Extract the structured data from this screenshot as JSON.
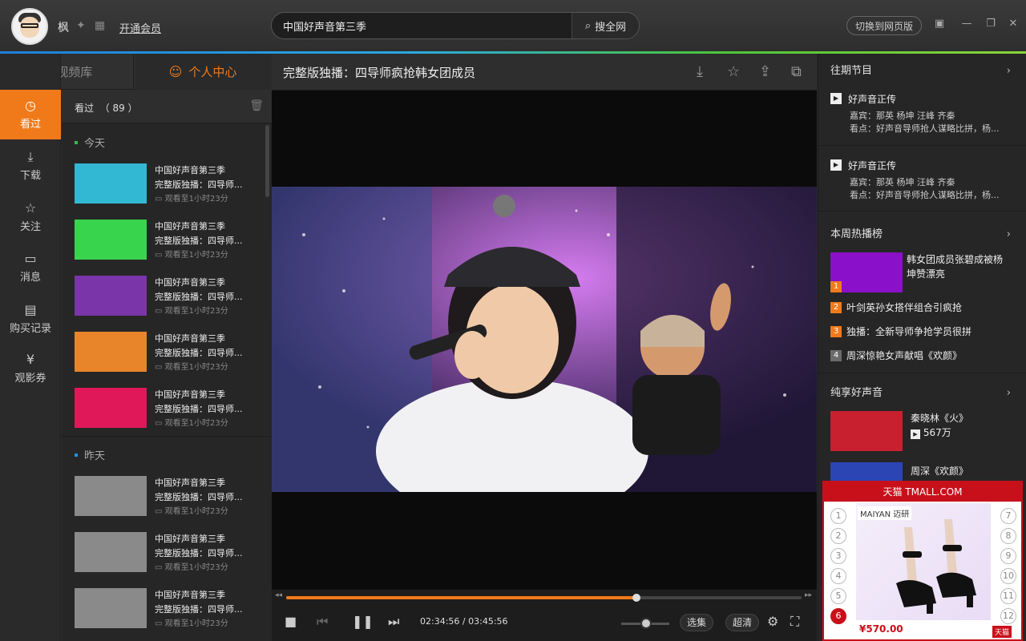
{
  "header": {
    "username": "枫",
    "vip_link": "开通会员",
    "search_value": "中国好声音第三季",
    "search_button": "搜全网",
    "switch_button": "切换到网页版"
  },
  "tabs": [
    {
      "label": "视频库"
    },
    {
      "label": "个人中心"
    }
  ],
  "leftnav": [
    {
      "label": "看过",
      "icon": "clock-icon",
      "active": true
    },
    {
      "label": "下载",
      "icon": "download-icon"
    },
    {
      "label": "关注",
      "icon": "star-icon"
    },
    {
      "label": "消息",
      "icon": "message-icon"
    },
    {
      "label": "购买记录",
      "icon": "receipt-icon"
    },
    {
      "label": "观影券",
      "icon": "ticket-icon"
    }
  ],
  "history": {
    "title": "看过",
    "count": "（ 89 ）",
    "today_label": "今天",
    "yesterday_label": "昨天",
    "today": [
      {
        "title": "中国好声音第三季",
        "subtitle": "完整版独播：四导师...",
        "progress": "观看至1小时23分",
        "color": "#33b8d4"
      },
      {
        "title": "中国好声音第三季",
        "subtitle": "完整版独播：四导师...",
        "progress": "观看至1小时23分",
        "color": "#38d44d"
      },
      {
        "title": "中国好声音第三季",
        "subtitle": "完整版独播：四导师...",
        "progress": "观看至1小时23分",
        "color": "#7a36a8"
      },
      {
        "title": "中国好声音第三季",
        "subtitle": "完整版独播：四导师...",
        "progress": "观看至1小时23分",
        "color": "#e8852a"
      },
      {
        "title": "中国好声音第三季",
        "subtitle": "完整版独播：四导师...",
        "progress": "观看至1小时23分",
        "color": "#e0185a"
      }
    ],
    "yesterday": [
      {
        "title": "中国好声音第三季",
        "subtitle": "完整版独播：四导师...",
        "progress": "观看至1小时23分",
        "color": "#8a8a8a"
      },
      {
        "title": "中国好声音第三季",
        "subtitle": "完整版独播：四导师...",
        "progress": "观看至1小时23分",
        "color": "#8a8a8a"
      },
      {
        "title": "中国好声音第三季",
        "subtitle": "完整版独播：四导师...",
        "progress": "观看至1小时23分",
        "color": "#8a8a8a"
      }
    ]
  },
  "player": {
    "title": "完整版独播：四导师疯抢韩女团成员",
    "time_current": "02:34:56",
    "time_sep": "/",
    "time_total": "03:45:56",
    "progress_fraction": 0.68,
    "select_button": "选集",
    "quality_button": "超清"
  },
  "right": {
    "past_title": "往期节目",
    "past": [
      {
        "title": "好声音正传",
        "guests": "嘉宾：那英 杨坤 汪峰 齐秦",
        "highlight": "看点：好声音导师抢人谋略比拼，杨..."
      },
      {
        "title": "好声音正传",
        "guests": "嘉宾：那英 杨坤 汪峰 齐秦",
        "highlight": "看点：好声音导师抢人谋略比拼，杨..."
      }
    ],
    "hot_title": "本周热播榜",
    "hot_top": "韩女团成员张碧成被杨坤赞漂亮",
    "hot": [
      {
        "n": "1",
        "color": "#f07a1a"
      },
      {
        "n": "2",
        "label": "叶剑英孙女搭伴组合引疯抢",
        "color": "#f07a1a"
      },
      {
        "n": "3",
        "label": "独播：全新导师争抢学员很拼",
        "color": "#f07a1a"
      },
      {
        "n": "4",
        "label": "周深惊艳女声献唱《欢颜》",
        "color": "#6a6a6a"
      }
    ],
    "pure_title": "纯享好声音",
    "pure": [
      {
        "title": "秦晓林《火》",
        "views": "567万",
        "color": "#c8202f"
      },
      {
        "title": "周深《欢颜》",
        "color": "#2b45b5"
      }
    ]
  },
  "ad": {
    "header": "天猫 TMALL.COM",
    "brand": "MAIYAN 迈研",
    "price": "¥570.00",
    "tmall_tag": "天猫",
    "left_numbers": [
      "1",
      "2",
      "3",
      "4",
      "5",
      "6"
    ],
    "right_numbers": [
      "7",
      "8",
      "9",
      "10",
      "11",
      "12"
    ],
    "active": "6"
  }
}
